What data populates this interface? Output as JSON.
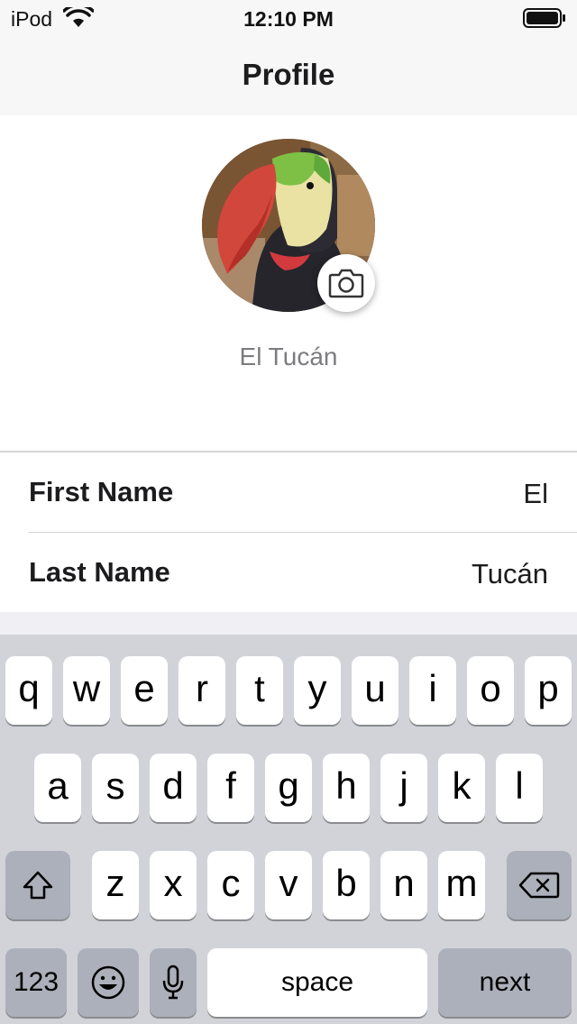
{
  "status_bar": {
    "carrier": "iPod",
    "time": "12:10 PM",
    "wifi_icon": "wifi-icon",
    "battery_icon": "battery-full-icon"
  },
  "nav": {
    "title": "Profile"
  },
  "profile": {
    "display_name": "El Tucán",
    "avatar": "toucan-photo",
    "camera_icon": "camera-icon"
  },
  "form": {
    "rows": [
      {
        "label": "First Name",
        "value": "El"
      },
      {
        "label": "Last Name",
        "value": "Tucán"
      }
    ]
  },
  "keyboard": {
    "row1": [
      "q",
      "w",
      "e",
      "r",
      "t",
      "y",
      "u",
      "i",
      "o",
      "p"
    ],
    "row2": [
      "a",
      "s",
      "d",
      "f",
      "g",
      "h",
      "j",
      "k",
      "l"
    ],
    "row3": [
      "z",
      "x",
      "c",
      "v",
      "b",
      "n",
      "m"
    ],
    "numbers_label": "123",
    "space_label": "space",
    "return_label": "next",
    "shift_icon": "shift-icon",
    "delete_icon": "delete-icon",
    "emoji_icon": "emoji-icon",
    "mic_icon": "microphone-icon"
  }
}
